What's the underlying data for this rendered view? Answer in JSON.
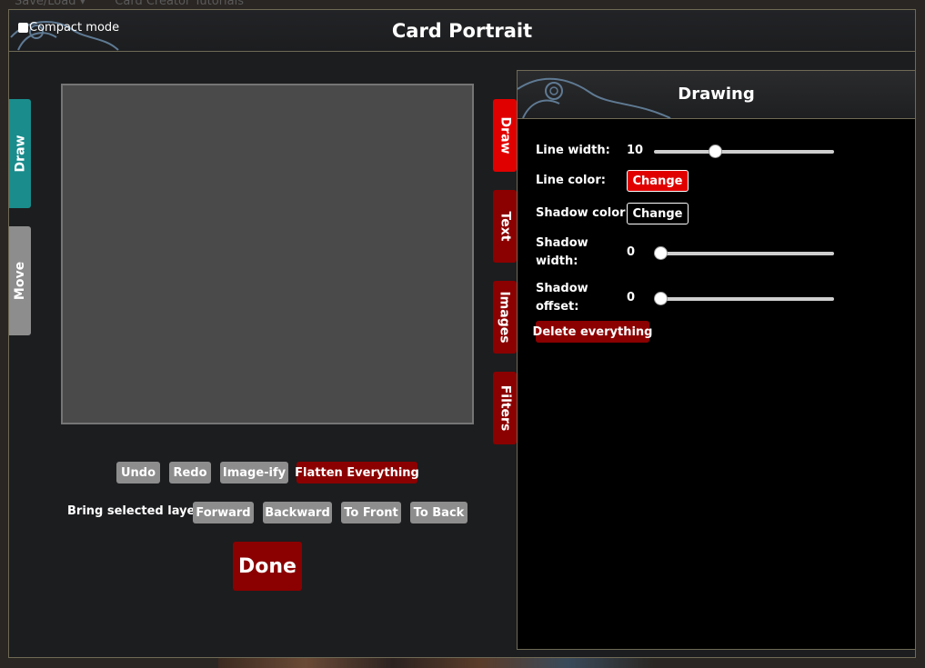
{
  "background": {
    "menu_items": [
      "Save/Load ▾",
      "Card Creator Tutorials"
    ]
  },
  "modal": {
    "title": "Card Portrait",
    "compact_mode_label": "Compact mode",
    "compact_mode_checked": false
  },
  "left_tabs": [
    {
      "label": "Draw",
      "active": true,
      "color": "#1a8c8c"
    },
    {
      "label": "Move",
      "active": false,
      "color": "#8d8d8d"
    }
  ],
  "right_tabs": [
    {
      "label": "Draw",
      "active": true
    },
    {
      "label": "Text",
      "active": false
    },
    {
      "label": "Images",
      "active": false
    },
    {
      "label": "Filters",
      "active": false
    }
  ],
  "actions": {
    "undo": "Undo",
    "redo": "Redo",
    "imageify": "Image-ify",
    "flatten": "Flatten Everything"
  },
  "layer": {
    "label": "Bring selected layer:",
    "forward": "Forward",
    "backward": "Backward",
    "to_front": "To Front",
    "to_back": "To Back"
  },
  "done_label": "Done",
  "drawing_panel": {
    "title": "Drawing",
    "line_width_label": "Line width:",
    "line_width_value": "10",
    "line_width_level": 0.33,
    "line_color_label": "Line color:",
    "line_color_button": "Change",
    "shadow_color_label": "Shadow color:",
    "shadow_color_button": "Change",
    "shadow_width_label_1": "Shadow",
    "shadow_width_label_2": "width:",
    "shadow_width_value": "0",
    "shadow_width_level": 0.0,
    "shadow_offset_label_1": "Shadow",
    "shadow_offset_label_2": "offset:",
    "shadow_offset_value": "0",
    "shadow_offset_level": 0.0,
    "delete_label": "Delete everything"
  },
  "colors": {
    "accent_teal": "#1a8c8c",
    "accent_red": "#e00000",
    "dark_red": "#8b0000",
    "gray_button": "#8d8d8d",
    "border_gold": "#6f6a55"
  }
}
